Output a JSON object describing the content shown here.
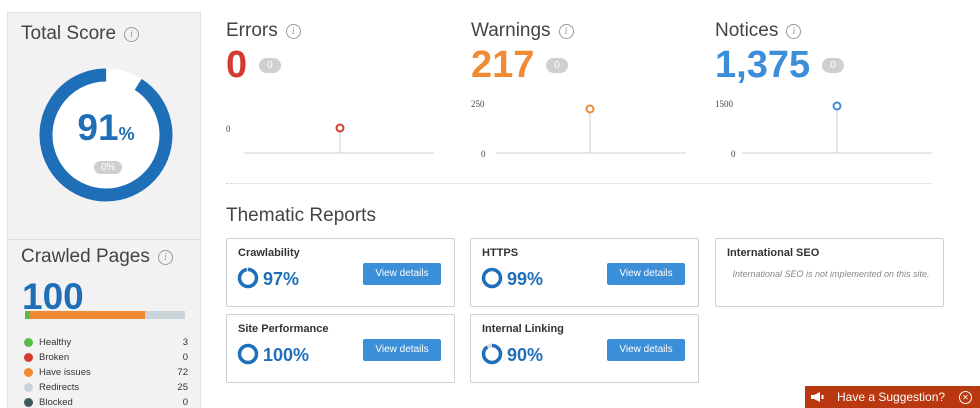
{
  "total_score": {
    "title": "Total Score",
    "value": "91",
    "unit": "%",
    "change": "0%",
    "fraction": 0.91
  },
  "crawled_pages": {
    "title": "Crawled Pages",
    "value": "100",
    "legend": [
      {
        "label": "Healthy",
        "value": "3",
        "color": "#59b94b",
        "count": 3
      },
      {
        "label": "Broken",
        "value": "0",
        "color": "#d43b2f",
        "count": 0
      },
      {
        "label": "Have issues",
        "value": "72",
        "color": "#f08a33",
        "count": 72
      },
      {
        "label": "Redirects",
        "value": "25",
        "color": "#c8d4d8",
        "count": 25
      },
      {
        "label": "Blocked",
        "value": "0",
        "color": "#3d5962",
        "count": 0
      }
    ]
  },
  "metrics": {
    "errors": {
      "title": "Errors",
      "value": "0",
      "badge": "0",
      "color": "#d43b2f",
      "max_label": "",
      "zero_label": "0"
    },
    "warnings": {
      "title": "Warnings",
      "value": "217",
      "badge": "0",
      "color": "#f08a33",
      "max_label": "250",
      "zero_label": "0"
    },
    "notices": {
      "title": "Notices",
      "value": "1,375",
      "badge": "0",
      "color": "#3b8ed8",
      "max_label": "1500",
      "zero_label": "0"
    }
  },
  "thematic": {
    "title": "Thematic Reports",
    "cards": [
      {
        "title": "Crawlability",
        "pct": "97%",
        "fraction": 0.97,
        "button": "View details"
      },
      {
        "title": "HTTPS",
        "pct": "99%",
        "fraction": 0.99,
        "button": "View details"
      },
      {
        "title": "International SEO",
        "note": "International SEO is not implemented on this site."
      },
      {
        "title": "Site Performance",
        "pct": "100%",
        "fraction": 1.0,
        "button": "View details"
      },
      {
        "title": "Internal Linking",
        "pct": "90%",
        "fraction": 0.9,
        "button": "View details"
      }
    ]
  },
  "suggestion": {
    "label": "Have a Suggestion?"
  },
  "icons": {
    "info": "info-icon",
    "megaphone": "megaphone-icon",
    "close": "close-icon"
  },
  "colors": {
    "primary": "#1f6fb8",
    "button": "#3b8ed8",
    "suggest_bg": "#b9380f"
  }
}
